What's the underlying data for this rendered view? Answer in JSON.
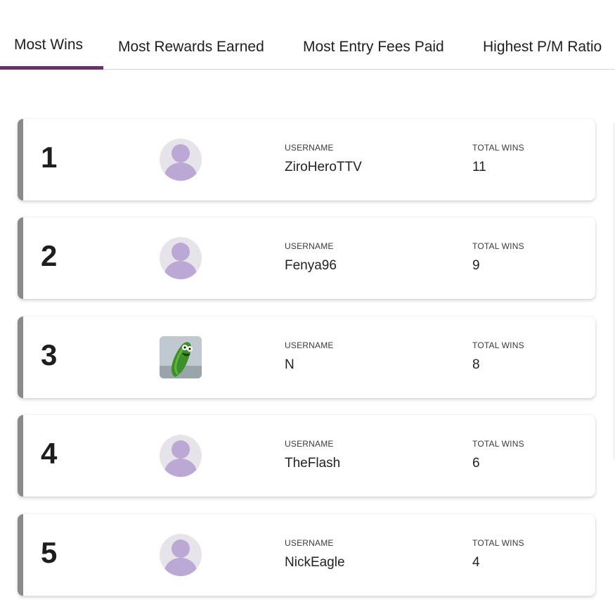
{
  "tabs": [
    {
      "label": "Most Wins",
      "active": true
    },
    {
      "label": "Most Rewards Earned"
    },
    {
      "label": "Most Entry Fees Paid"
    },
    {
      "label": "Highest P/M Ratio"
    }
  ],
  "colors": {
    "accent": "#6a2f6e",
    "rank_bar": "#8a8a8a",
    "avatar_fill": "#bca8d4",
    "avatar_bg": "#e6e4ea"
  },
  "columns": {
    "username_label": "USERNAME",
    "wins_label": "TOTAL WINS"
  },
  "leaderboard": [
    {
      "rank": "1",
      "username": "ZiroHeroTTV",
      "wins": "11",
      "avatar": "default-user-icon"
    },
    {
      "rank": "2",
      "username": "Fenya96",
      "wins": "9",
      "avatar": "default-user-icon"
    },
    {
      "rank": "3",
      "username": "N",
      "wins": "8",
      "avatar": "pickle-image"
    },
    {
      "rank": "4",
      "username": "TheFlash",
      "wins": "6",
      "avatar": "default-user-icon"
    },
    {
      "rank": "5",
      "username": "NickEagle",
      "wins": "4",
      "avatar": "default-user-icon"
    }
  ]
}
